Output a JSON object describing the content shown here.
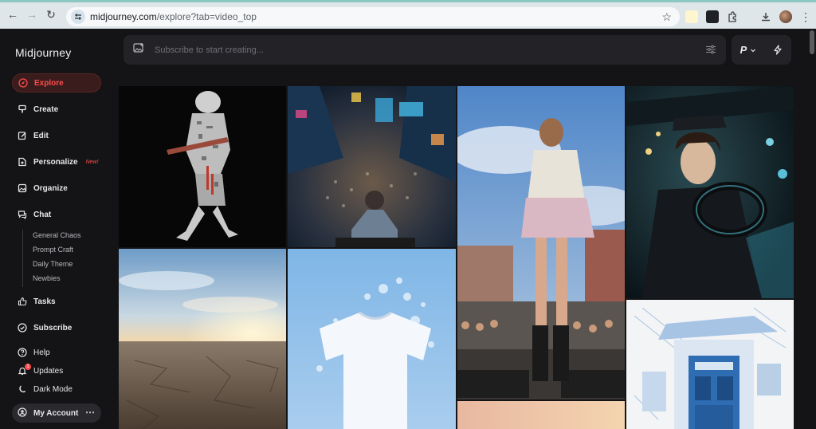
{
  "browser": {
    "url_host": "midjourney.com",
    "url_path": "/explore?tab=video_top"
  },
  "app": {
    "logo": "Midjourney",
    "prompt_placeholder": "Subscribe to start creating...",
    "mode_label": "P"
  },
  "sidebar": {
    "items": [
      {
        "label": "Explore",
        "icon": "compass-icon"
      },
      {
        "label": "Create",
        "icon": "brush-icon"
      },
      {
        "label": "Edit",
        "icon": "edit-icon"
      },
      {
        "label": "Personalize",
        "icon": "personalize-icon",
        "badge": "New!"
      },
      {
        "label": "Organize",
        "icon": "image-icon"
      },
      {
        "label": "Chat",
        "icon": "chat-icon"
      },
      {
        "label": "Tasks",
        "icon": "thumbs-up-icon"
      },
      {
        "label": "Subscribe",
        "icon": "subscribe-icon"
      },
      {
        "label": "Help",
        "icon": "help-icon"
      },
      {
        "label": "Updates",
        "icon": "bell-icon",
        "count": "1"
      },
      {
        "label": "Dark Mode",
        "icon": "moon-icon"
      }
    ],
    "chat_channels": [
      "General Chaos",
      "Prompt Craft",
      "Daily Theme",
      "Newbies"
    ],
    "account_label": "My Account"
  },
  "gallery": {
    "tiles": [
      {
        "subject": "samurai-typography"
      },
      {
        "subject": "city-crossing-aerial"
      },
      {
        "subject": "woman-city-square"
      },
      {
        "subject": "woman-driving-car"
      },
      {
        "subject": "desert-sunset"
      },
      {
        "subject": "white-tshirt-splash"
      },
      {
        "subject": "blue-building-sketch"
      },
      {
        "subject": "sunset-strip"
      }
    ]
  },
  "colors": {
    "accent": "#ff4b4b",
    "background": "#141417",
    "panel": "#232327"
  }
}
